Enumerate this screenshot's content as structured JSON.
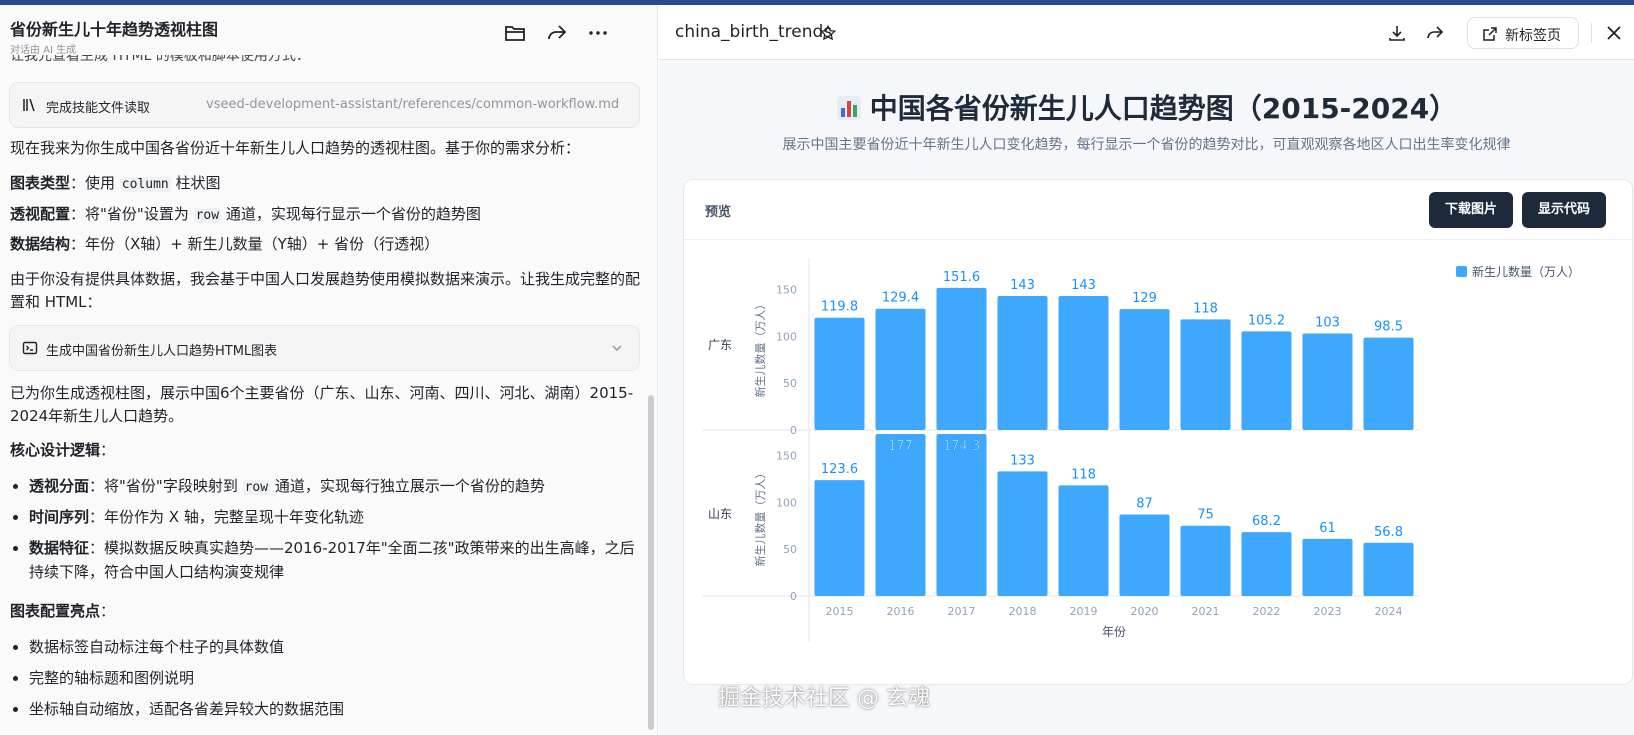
{
  "left_panel": {
    "title": "省份新生儿十年趋势透视柱图",
    "subtitle": "对话由 AI 生成",
    "cut_text": "让我先查看生成 HTML 的模板和脚本使用方式：",
    "skill_box": {
      "label": "完成技能文件读取",
      "path": "vseed-development-assistant/references/common-workflow.md"
    },
    "intro": "现在我来为你生成中国各省份近十年新生儿人口趋势的透视柱图。基于你的需求分析：",
    "req1_label": "图表类型",
    "req1_a": "：使用 ",
    "req1_code": "column",
    "req1_b": " 柱状图",
    "req2_label": "透视配置",
    "req2_a": "：将\"省份\"设置为 ",
    "req2_code": "row",
    "req2_b": " 通道，实现每行显示一个省份的趋势图",
    "req3_label": "数据结构",
    "req3_text": "：年份（X轴）+ 新生儿数量（Y轴）+ 省份（行透视）",
    "mock_note": "由于你没有提供具体数据，我会基于中国人口发展趋势使用模拟数据来演示。让我生成完整的配置和 HTML：",
    "tool_box": {
      "label": "生成中国省份新生儿人口趋势HTML图表"
    },
    "done_text": "已为你生成透视柱图，展示中国6个主要省份（广东、山东、河南、四川、河北、湖南）2015-2024年新生儿人口趋势。",
    "core_title": "核心设计逻辑",
    "colon": "：",
    "b1_label": "透视分面",
    "b1_a": "：将\"省份\"字段映射到 ",
    "b1_code": "row",
    "b1_b": " 通道，实现每行独立展示一个省份的趋势",
    "b2_label": "时间序列",
    "b2_text": "：年份作为 X 轴，完整呈现十年变化轨迹",
    "b3_label": "数据特征",
    "b3_text": "：模拟数据反映真实趋势——2016-2017年\"全面二孩\"政策带来的出生高峰，之后持续下降，符合中国人口结构演变规律",
    "hl_title": "图表配置亮点",
    "h1": "数据标签自动标注每个柱子的具体数值",
    "h2": "完整的轴标题和图例说明",
    "h3": "坐标轴自动缩放，适配各省差异较大的数据范围"
  },
  "right_panel": {
    "file_name": "china_birth_trends",
    "new_tab_label": "新标签页",
    "page_title": "中国各省份新生儿人口趋势图（2015-2024）",
    "page_subtitle": "展示中国主要省份近十年新生儿人口变化趋势，每行显示一个省份的趋势对比，可直观观察各地区人口出生率变化规律",
    "card_label": "预览",
    "download_label": "下载图片",
    "code_label": "显示代码"
  },
  "watermark": "掘金技术社区 @ 玄魂",
  "colors": {
    "bar": "#3ea8ff",
    "label": "#1890ff",
    "accent": "#1e293b"
  },
  "chart_data": {
    "type": "bar",
    "categories": [
      "2015",
      "2016",
      "2017",
      "2018",
      "2019",
      "2020",
      "2021",
      "2022",
      "2023",
      "2024"
    ],
    "series_name": "新生儿数量（万人）",
    "ylabel": "新生儿数量（万人）",
    "xlabel": "年份",
    "legend": "top-right",
    "rows": [
      {
        "name": "广东",
        "values": [
          119.8,
          129.4,
          151.6,
          143,
          143,
          129,
          118,
          105.2,
          103,
          98.5
        ],
        "ylim": [
          0,
          160
        ],
        "ticks": [
          0,
          50,
          100,
          150
        ]
      },
      {
        "name": "山东",
        "values": [
          123.6,
          177,
          174.3,
          133,
          118,
          87,
          75,
          68.2,
          61,
          56.8
        ],
        "ylim": [
          0,
          160
        ],
        "ticks": [
          0,
          50,
          100,
          150
        ]
      }
    ]
  }
}
